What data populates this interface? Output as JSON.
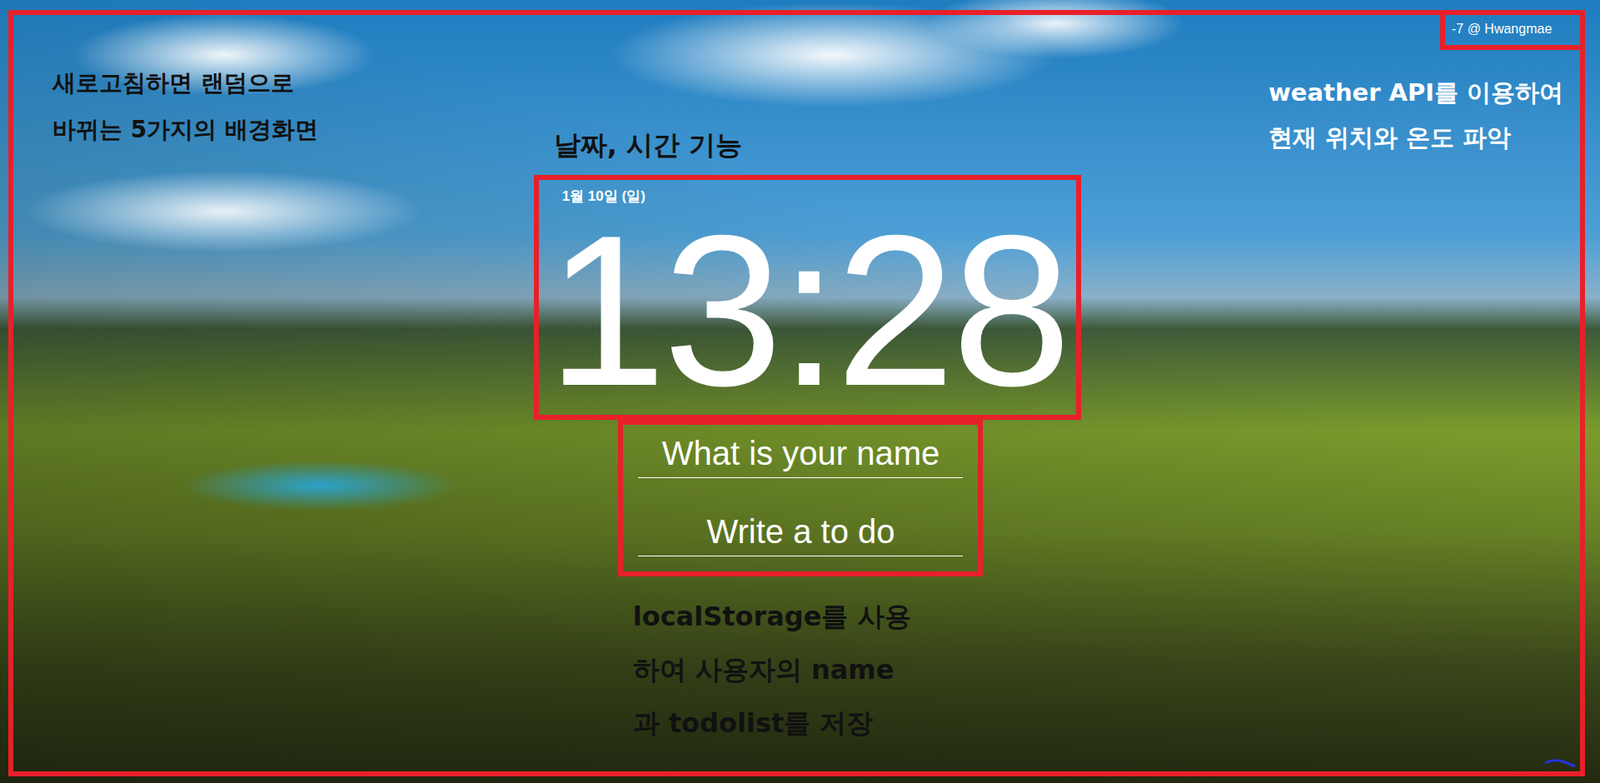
{
  "weather": {
    "text": "-7 @ Hwangmae"
  },
  "clock": {
    "date": "1월 10일 (일)",
    "time": "13:28"
  },
  "form": {
    "name_placeholder": "What is your name",
    "todo_placeholder": "Write a to do"
  },
  "annotations": {
    "background": [
      "새로고침하면 랜덤으로",
      "바뀌는 5가지의 배경화면"
    ],
    "clock": [
      "날짜, 시간 기능"
    ],
    "weather": [
      "weather API를 이용하여",
      "현재 위치와 온도 파악"
    ],
    "storage": [
      "localStorage를 사용",
      "하여 사용자의 name",
      "과 todolist를 저장"
    ]
  }
}
